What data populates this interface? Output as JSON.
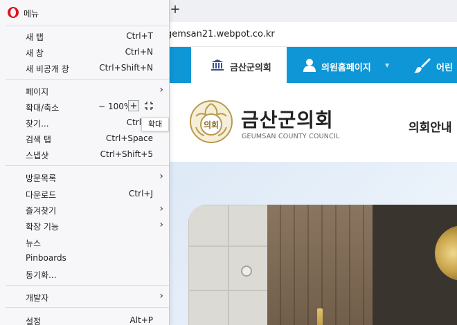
{
  "browser": {
    "new_tab_glyph": "+",
    "url": "gemsan21.webpot.co.kr"
  },
  "site": {
    "nav": {
      "home": "금산군의회",
      "member": "의원홈페이지",
      "kids": "어린"
    },
    "brand_title": "금산군의회",
    "brand_sub": "GEUMSAN COUNTY COUNCIL",
    "intro": "의회안내",
    "seal_text": "의회"
  },
  "menu": {
    "title": "메뉴",
    "items": {
      "new_tab": {
        "label": "새 탭",
        "shortcut": "Ctrl+T"
      },
      "new_window": {
        "label": "새 창",
        "shortcut": "Ctrl+N"
      },
      "new_private": {
        "label": "새 비공개 창",
        "shortcut": "Ctrl+Shift+N"
      },
      "page": {
        "label": "페이지"
      },
      "zoom": {
        "label": "확대/축소",
        "minus": "−",
        "value": "100%",
        "plus": "+"
      },
      "find": {
        "label": "찾기...",
        "shortcut": "Ctrl+F"
      },
      "search_tabs": {
        "label": "검색 탭",
        "shortcut": "Ctrl+Space"
      },
      "snapshot": {
        "label": "스냅샷",
        "shortcut": "Ctrl+Shift+5"
      },
      "history": {
        "label": "방문목록"
      },
      "downloads": {
        "label": "다운로드",
        "shortcut": "Ctrl+J"
      },
      "bookmarks": {
        "label": "즐겨찾기"
      },
      "extensions": {
        "label": "확장 기능"
      },
      "news": {
        "label": "뉴스"
      },
      "pinboards": {
        "label": "Pinboards"
      },
      "sync": {
        "label": "동기화..."
      },
      "developer": {
        "label": "개발자"
      },
      "settings": {
        "label": "설정",
        "shortcut": "Alt+P"
      }
    },
    "tooltip": "확대"
  },
  "colors": {
    "nav_blue": "#0e96d6",
    "opera_red": "#e0141e"
  }
}
